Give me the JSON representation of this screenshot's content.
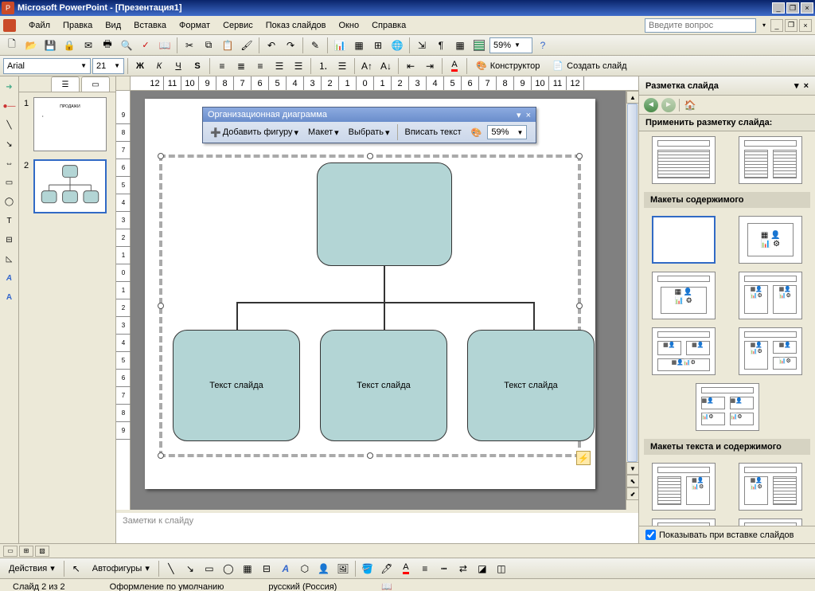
{
  "title_bar": {
    "text": "Microsoft PowerPoint - [Презентация1]"
  },
  "menus": [
    "Файл",
    "Правка",
    "Вид",
    "Вставка",
    "Формат",
    "Сервис",
    "Показ слайдов",
    "Окно",
    "Справка"
  ],
  "ask_box": {
    "placeholder": "Введите вопрос"
  },
  "toolbar1": {
    "zoom": "59%"
  },
  "toolbar2": {
    "font": "Arial",
    "size": "21",
    "designer": "Конструктор",
    "new_slide": "Создать слайд"
  },
  "float_tb": {
    "title": "Организационная диаграмма",
    "add_shape": "Добавить фигуру",
    "layout": "Макет",
    "select": "Выбрать",
    "fit_text": "Вписать текст",
    "zoom": "59%"
  },
  "org": {
    "child1": "Текст слайда",
    "child2": "Текст слайда",
    "child3": "Текст слайда"
  },
  "thumb": {
    "tab1": "☰",
    "tab2": "▭",
    "s1_title": "ПРОДАЖИ"
  },
  "notes": {
    "placeholder": "Заметки к слайду"
  },
  "task_pane": {
    "title": "Разметка слайда",
    "apply": "Применить разметку слайда:",
    "sec_content": "Макеты содержимого",
    "sec_text_content": "Макеты текста и содержимого",
    "show_on_insert": "Показывать при вставке слайдов"
  },
  "draw_bar": {
    "actions": "Действия",
    "autoshapes": "Автофигуры"
  },
  "status": {
    "slide": "Слайд 2 из 2",
    "design": "Оформление по умолчанию",
    "lang": "русский (Россия)"
  },
  "ruler_ticks": [
    "12",
    "11",
    "10",
    "9",
    "8",
    "7",
    "6",
    "5",
    "4",
    "3",
    "2",
    "1",
    "0",
    "1",
    "2",
    "3",
    "4",
    "5",
    "6",
    "7",
    "8",
    "9",
    "10",
    "11",
    "12"
  ]
}
